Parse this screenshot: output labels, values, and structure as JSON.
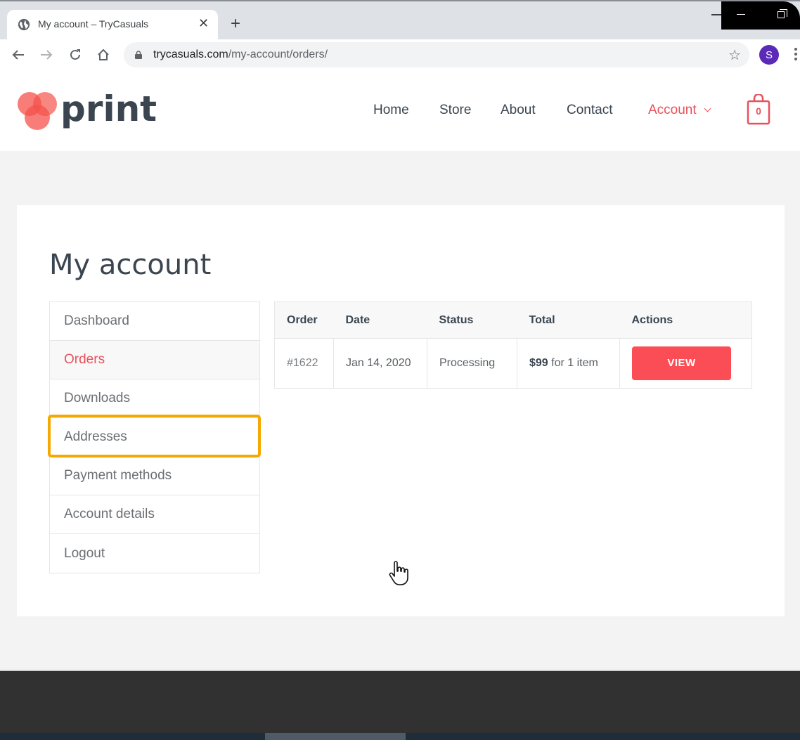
{
  "browser": {
    "tab_title": "My account – TryCasuals",
    "tab_favicon": "globe-icon",
    "url_domain": "trycasuals.com",
    "url_path": "/my-account/orders/",
    "profile_initial": "S",
    "colors": {
      "profile": "#5b2ab8"
    }
  },
  "site": {
    "logo_text": "print",
    "nav": [
      {
        "label": "Home",
        "active": false
      },
      {
        "label": "Store",
        "active": false
      },
      {
        "label": "About",
        "active": false
      },
      {
        "label": "Contact",
        "active": false
      },
      {
        "label": "Account",
        "active": true,
        "has_dropdown": true
      }
    ],
    "cart_count": "0",
    "colors": {
      "accent": "#e9515c",
      "text": "#3a4550",
      "button": "#fb4d55",
      "highlight": "#f5a800"
    }
  },
  "account": {
    "title": "My account",
    "menu": [
      {
        "label": "Dashboard",
        "active": false
      },
      {
        "label": "Orders",
        "active": true
      },
      {
        "label": "Downloads",
        "active": false
      },
      {
        "label": "Addresses",
        "active": false,
        "highlighted": true
      },
      {
        "label": "Payment methods",
        "active": false
      },
      {
        "label": "Account details",
        "active": false
      },
      {
        "label": "Logout",
        "active": false
      }
    ],
    "orders": {
      "headers": [
        "Order",
        "Date",
        "Status",
        "Total",
        "Actions"
      ],
      "rows": [
        {
          "order": "#1622",
          "date": "Jan 14, 2020",
          "status": "Processing",
          "total_amount": "$99",
          "total_suffix": " for 1 item",
          "action_label": "VIEW"
        }
      ]
    }
  }
}
